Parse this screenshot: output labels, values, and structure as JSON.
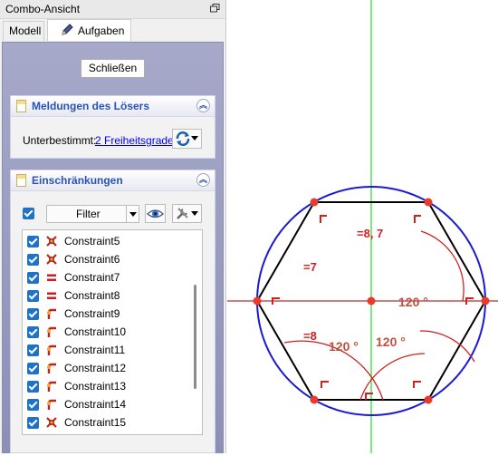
{
  "window": {
    "title": "Combo-Ansicht"
  },
  "tabs": [
    {
      "label": "Modell"
    },
    {
      "label": "Aufgaben"
    }
  ],
  "task": {
    "close_label": "Schließen"
  },
  "solver": {
    "title": "Meldungen des Lösers",
    "status_label": "Unterbestimmt:",
    "status_link": "2 Freiheitsgrade"
  },
  "constraints_panel": {
    "title": "Einschränkungen",
    "filter_label": "Filter",
    "items": [
      {
        "name": "Constraint5",
        "icon": "coincident-icon"
      },
      {
        "name": "Constraint6",
        "icon": "coincident-icon"
      },
      {
        "name": "Constraint7",
        "icon": "equal-icon"
      },
      {
        "name": "Constraint8",
        "icon": "equal-icon"
      },
      {
        "name": "Constraint9",
        "icon": "point-on-object-icon"
      },
      {
        "name": "Constraint10",
        "icon": "point-on-object-icon"
      },
      {
        "name": "Constraint11",
        "icon": "point-on-object-icon"
      },
      {
        "name": "Constraint12",
        "icon": "point-on-object-icon"
      },
      {
        "name": "Constraint13",
        "icon": "point-on-object-icon"
      },
      {
        "name": "Constraint14",
        "icon": "point-on-object-icon"
      },
      {
        "name": "Constraint15",
        "icon": "coincident-icon"
      }
    ]
  },
  "sketch": {
    "equal_labels": [
      "=8, 7",
      "=7",
      "=8"
    ],
    "angle_labels": [
      "120 °",
      "120 °",
      "120 °"
    ],
    "colors": {
      "circle": "#1a1ad2",
      "hexagon": "#000000",
      "constraint": "#d02020",
      "axis_h": "#b33030",
      "axis_v": "#22dd22"
    }
  }
}
